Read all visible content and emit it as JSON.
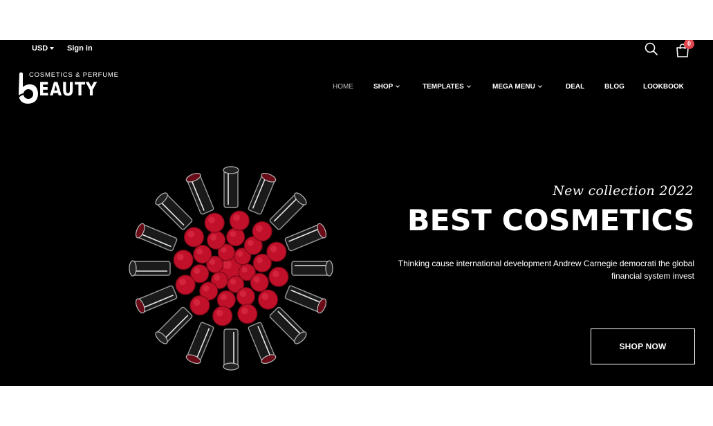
{
  "topbar": {
    "currency": "USD",
    "signin_label": "Sign in",
    "cart_count": "0"
  },
  "logo": {
    "tagline": "COSMETICS & PERFUME",
    "wordmark": "EAUTY",
    "letter": "b"
  },
  "nav": {
    "items": [
      {
        "label": "HOME",
        "dropdown": false,
        "active": true
      },
      {
        "label": "SHOP",
        "dropdown": true
      },
      {
        "label": "TEMPLATES",
        "dropdown": true
      },
      {
        "label": "MEGA MENU",
        "dropdown": true
      },
      {
        "label": "DEAL",
        "dropdown": false
      },
      {
        "label": "BLOG",
        "dropdown": false
      },
      {
        "label": "LOOKBOOK",
        "dropdown": false
      }
    ]
  },
  "hero": {
    "subtitle": "New collection 2022",
    "title": "BEST COSMETICS",
    "description_line1": "Thinking cause international development Andrew Carnegie democrati the global",
    "description_line2": "financial system invest",
    "cta_label": "SHOP NOW"
  },
  "icons": {
    "search": "search-icon",
    "cart": "shopping-bag-icon",
    "currency_caret": "caret-down-icon"
  },
  "colors": {
    "background": "#000000",
    "text": "#ffffff",
    "badge": "#e0454f",
    "lipstick_red": "#c0102a",
    "nav_active": "#bdbdbd"
  }
}
